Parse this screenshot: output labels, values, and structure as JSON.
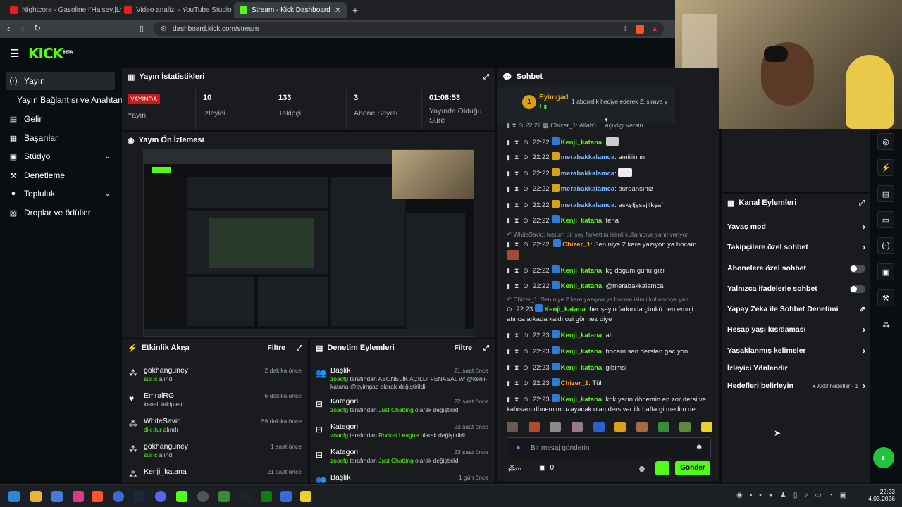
{
  "browser": {
    "tabs": [
      {
        "title": "Nightcore - Gasoline I'Halsey,|Lyri",
        "color": "#e62117",
        "active": false
      },
      {
        "title": "Video analizi - YouTube Studio",
        "color": "#e62117",
        "active": false
      },
      {
        "title": "Stream - Kick Dashboard",
        "color": "#53fc18",
        "active": true
      }
    ],
    "url": "dashboard.kick.com/stream"
  },
  "logo": {
    "text": "KICK",
    "sup": "BETA"
  },
  "sidebar": {
    "items": [
      {
        "label": "Yayın",
        "icon": "broadcast-icon",
        "glyph": "((·))",
        "active": true
      },
      {
        "label": "Yayın Bağlantısı ve Anahtarı",
        "icon": "",
        "glyph": "",
        "active": false
      },
      {
        "label": "Gelir",
        "icon": "revenue-icon",
        "glyph": "▤",
        "active": false
      },
      {
        "label": "Başarılar",
        "icon": "achievements-icon",
        "glyph": "▦",
        "active": false
      },
      {
        "label": "Stüdyo",
        "icon": "studio-icon",
        "glyph": "▣",
        "active": false,
        "chevron": true
      },
      {
        "label": "Denetleme",
        "icon": "moderation-icon",
        "glyph": "⚒",
        "active": false
      },
      {
        "label": "Topluluk",
        "icon": "community-icon",
        "glyph": "👤",
        "active": false,
        "chevron": true
      },
      {
        "label": "Droplar ve ödüller",
        "icon": "drops-icon",
        "glyph": "🎁",
        "active": false
      }
    ]
  },
  "stats": {
    "title": "Yayın İstatistikleri",
    "status": "YAYINDA",
    "status_label": "Yayın",
    "viewers": "10",
    "viewers_label": "İzleyici",
    "followers": "133",
    "followers_label": "Takipçi",
    "subs": "3",
    "subs_label": "Abone Sayısı",
    "uptime": "01:08:53",
    "uptime_label": "Yayında Olduğu Süre"
  },
  "preview": {
    "title": "Yayın Ön İzlemesi"
  },
  "activity": {
    "title": "Etkinlik Akışı",
    "filter": "Filtre",
    "items": [
      {
        "icon": "follow-icon",
        "glyph": "⁂",
        "name": "gokhanguney",
        "detail_hl": "sui iç",
        "detail": " alındı",
        "time": "2 dakika önce"
      },
      {
        "icon": "heart-icon",
        "glyph": "♥",
        "name": "EmralRG",
        "detail_hl": "",
        "detail": "kanalı takip etti",
        "time": "6 dakika önce"
      },
      {
        "icon": "reward-icon",
        "glyph": "⁂",
        "name": "WhiteSavic",
        "detail_hl": "dik dur",
        "detail": " alındı",
        "time": "59 dakika önce"
      },
      {
        "icon": "reward-icon",
        "glyph": "⁂",
        "name": "gokhanguney",
        "detail_hl": "sui iç",
        "detail": " alındı",
        "time": "1 saat önce"
      },
      {
        "icon": "reward-icon",
        "glyph": "⁂",
        "name": "Kenji_katana",
        "detail_hl": "",
        "detail": "",
        "time": "21 saat önce"
      }
    ]
  },
  "mod": {
    "title": "Denetim Eylemleri",
    "filter": "Filtre",
    "items": [
      {
        "icon": "user-title-icon",
        "glyph": "👥",
        "name": "Başlık",
        "time": "21 saat önce",
        "by": "zoacfg",
        "mid": " tarafından ",
        "value": "ABONELİK AÇILDI FENASAL w/ @kenji-katana @eyimgad",
        "end": " olarak değiştirildi",
        "two": true
      },
      {
        "icon": "category-icon",
        "glyph": "⊟",
        "name": "Kategori",
        "time": "22 saat önce",
        "by": "zoacfg",
        "mid": " tarafından ",
        "value": "Just Chatting",
        "end": " olarak değiştirildi",
        "two": false
      },
      {
        "icon": "category-icon",
        "glyph": "⊟",
        "name": "Kategori",
        "time": "23 saat önce",
        "by": "zoacfg",
        "mid": " tarafından ",
        "value": "Rocket League",
        "end": " olarak değiştirildi",
        "two": false
      },
      {
        "icon": "category-icon",
        "glyph": "⊟",
        "name": "Kategori",
        "time": "23 saat önce",
        "by": "zoacfg",
        "mid": " tarafından ",
        "value": "Just Chatting",
        "end": " olarak değiştirildi",
        "two": false
      },
      {
        "icon": "user-title-icon",
        "glyph": "👥",
        "name": "Başlık",
        "time": "1 gün önce",
        "by": "",
        "mid": "",
        "value": "",
        "end": "",
        "two": false
      }
    ]
  },
  "chat": {
    "title": "Sohbet",
    "pinned_user": "Eyimgad",
    "pinned_rank": "1",
    "pinned_text": "1 abonelik hediye ederek 2. sıraya y",
    "messages": [
      {
        "time": "22:22",
        "user": "Kenji_katana",
        "color": "#53fc18",
        "badge": "#2e7bd6",
        "text": "",
        "emote": true
      },
      {
        "time": "22:22",
        "user": "merabakkalamca",
        "color": "#7ab7ff",
        "badge": "#d7a21a",
        "text": "amiiiinnn",
        "emote": false
      },
      {
        "time": "22:22",
        "user": "merabakkalamca",
        "color": "#7ab7ff",
        "badge": "#d7a21a",
        "text": "",
        "emote": true
      },
      {
        "time": "22:22",
        "user": "merabakkalamca",
        "color": "#7ab7ff",
        "badge": "#d7a21a",
        "text": "burdansınız",
        "emote": false
      },
      {
        "time": "22:22",
        "user": "merabakkalamca",
        "color": "#7ab7ff",
        "badge": "#d7a21a",
        "text": "askşfjşsajlfkşaf",
        "emote": false
      },
      {
        "time": "22:22",
        "user": "Kenji_katana",
        "color": "#53fc18",
        "badge": "#2e7bd6",
        "text": "fena",
        "emote": false
      }
    ],
    "sys1": "WhiteSavic: tostum bir şey farkettim isimli kullanıcıya yanıt veriyor",
    "msg_chizer1": {
      "time": "22:22",
      "user": "Chizer_1",
      "color": "#ff9e2c",
      "badge": "#2e7bd6",
      "text": "Sen niye 2 kere yazıyon ya hocam"
    },
    "messages2": [
      {
        "time": "22:22",
        "user": "Kenji_katana",
        "color": "#53fc18",
        "badge": "#2e7bd6",
        "text": "kg dogum gunu gızı"
      },
      {
        "time": "22:22",
        "user": "Kenji_katana",
        "color": "#53fc18",
        "badge": "#2e7bd6",
        "text": "@merabakkalamca"
      }
    ],
    "sys2": "Chizer_1: Sen niye 2 kere yazıyon ya hocam  isimli kullanıcıya yan",
    "msg_long": {
      "time": "22:23",
      "user": "Kenji_katana",
      "color": "#53fc18",
      "badge": "#2e7bd6",
      "text": "her şeyin farkında çünkü ben emoji atınca arkada kaldı ozi görmez diye"
    },
    "messages3": [
      {
        "time": "22:23",
        "user": "Kenji_katana",
        "color": "#53fc18",
        "badge": "#2e7bd6",
        "text": "attı"
      },
      {
        "time": "22:23",
        "user": "Kenji_katana",
        "color": "#53fc18",
        "badge": "#2e7bd6",
        "text": "hocam sen dersten gacıyon"
      },
      {
        "time": "22:23",
        "user": "Kenji_katana",
        "color": "#53fc18",
        "badge": "#2e7bd6",
        "text": "gibimsi"
      },
      {
        "time": "22:23",
        "user": "Chizer_1",
        "color": "#ff9e2c",
        "badge": "#2e7bd6",
        "text": "Tüh"
      }
    ],
    "msg_last": {
      "time": "22:23",
      "user": "Kenji_katana",
      "color": "#53fc18",
      "badge": "#2e7bd6",
      "text": "knk yarın dönemin en zor dersi ve kalırsam dönemim uzayacak olan ders var ilk hafta gitmedim de"
    },
    "input_placeholder": "Bir mesaj gönderin",
    "points": "0",
    "send": "Gönder"
  },
  "channel": {
    "title": "Kanal Eylemleri",
    "items": [
      {
        "label": "Yavaş mod",
        "kind": "arrow"
      },
      {
        "label": "Takipçilere özel sohbet",
        "kind": "arrow"
      },
      {
        "label": "Abonelere özel sohbet",
        "kind": "toggle"
      },
      {
        "label": "Yalnızca ifadelerle sohbet",
        "kind": "toggle"
      },
      {
        "label": "Yapay Zeka ile Sohbet Denetimi",
        "kind": "external"
      },
      {
        "label": "Hesap yaşı kısıtlaması",
        "kind": "arrow"
      },
      {
        "label": "Yasaklanmış kelimeler",
        "kind": "arrow"
      },
      {
        "label": "İzleyici Yönlendir",
        "kind": "none"
      },
      {
        "label": "Hedefleri belirleyin",
        "kind": "goal"
      }
    ],
    "goal_status": "Aktif hedefler - 1"
  },
  "taskbar": {
    "time": "22:23",
    "date": "4.03.2026"
  }
}
